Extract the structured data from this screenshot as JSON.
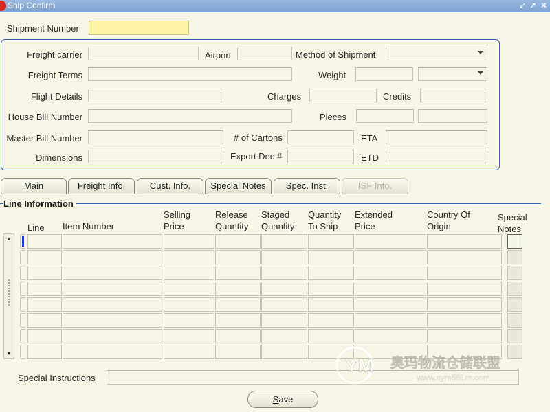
{
  "window": {
    "title": "Ship Confirm"
  },
  "header": {
    "shipment_number_label": "Shipment Number",
    "shipment_number_value": ""
  },
  "freight": {
    "carrier_label": "Freight carrier",
    "airport_label": "Airport",
    "method_label": "Method of Shipment",
    "terms_label": "Freight Terms",
    "weight_label": "Weight",
    "flight_label": "Flight Details",
    "charges_label": "Charges",
    "credits_label": "Credits",
    "house_bill_label": "House Bill Number",
    "pieces_label": "Pieces",
    "master_bill_label": "Master Bill Number",
    "cartons_label": "# of Cartons",
    "eta_label": "ETA",
    "dimensions_label": "Dimensions",
    "export_doc_label": "Export Doc #",
    "etd_label": "ETD"
  },
  "tabs": [
    {
      "key": "M",
      "rest": "ain"
    },
    {
      "key": "",
      "rest": "Freight Info."
    },
    {
      "key": "C",
      "rest": "ust. Info."
    },
    {
      "key": "Special ",
      "rest": "N",
      "tail": "otes"
    },
    {
      "key": "S",
      "rest": "pec. Inst."
    },
    {
      "key": "",
      "rest": "ISF Info."
    }
  ],
  "lines": {
    "section_title": "Line Information",
    "columns": {
      "line": "Line",
      "item": "Item Number",
      "selling_1": "Selling",
      "selling_2": "Price",
      "release_1": "Release",
      "release_2": "Quantity",
      "staged_1": "Staged",
      "staged_2": "Quantity",
      "qty_ship_1": "Quantity",
      "qty_ship_2": "To Ship",
      "extended_1": "Extended",
      "extended_2": "Price",
      "country_1": "Country Of",
      "country_2": "Origin",
      "notes_1": "Special",
      "notes_2": "Notes"
    },
    "row_count": 8
  },
  "footer": {
    "special_instructions_label": "Special Instructions",
    "save_label": "ave",
    "save_key": "S"
  },
  "watermark": {
    "text": "奥玛物流仓储联盟",
    "url": "www.cym56Lm.com"
  },
  "colors": {
    "required_field": "#fdf5a6",
    "titlebar": "#86a8d6",
    "group_border": "#3b63b0",
    "background": "#f7f5e6"
  }
}
